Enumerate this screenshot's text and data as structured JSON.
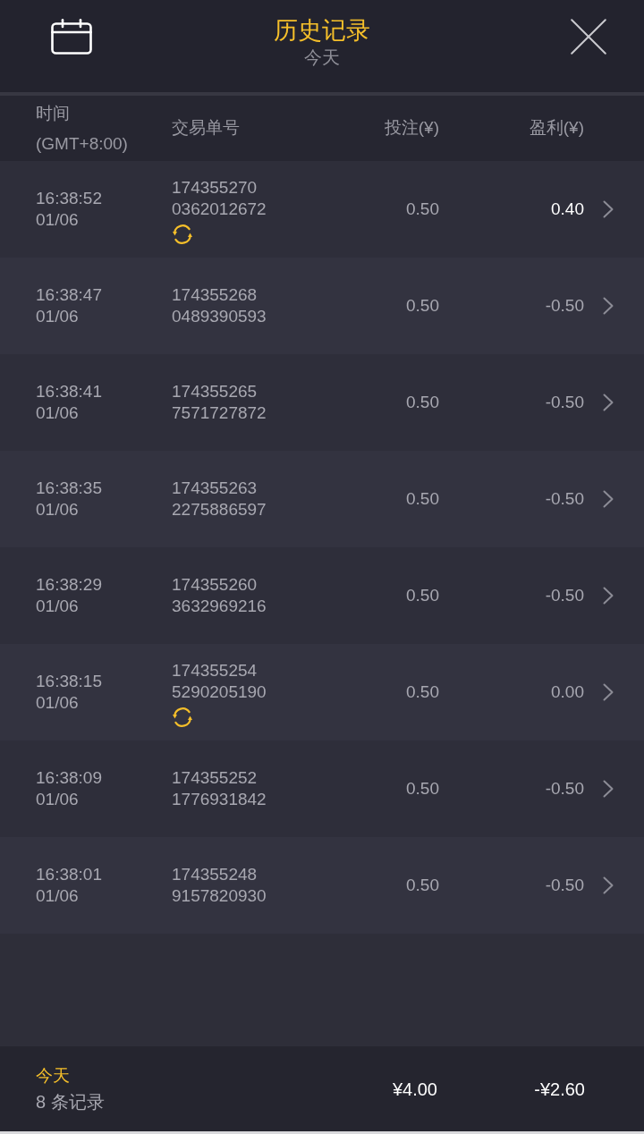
{
  "header": {
    "title": "历史记录",
    "subtitle": "今天"
  },
  "columns": [
    {
      "label": "时间",
      "sublabel": "(GMT+8:00)"
    },
    {
      "label": "交易单号"
    },
    {
      "label": "投注(¥)"
    },
    {
      "label": "盈利(¥)"
    }
  ],
  "rows": [
    {
      "time": "16:38:52",
      "date": "01/06",
      "order_no": [
        "174355270",
        "0362012672"
      ],
      "refresh_mark": true,
      "stake": "0.50",
      "profit": "0.40",
      "highlighted": true
    },
    {
      "time": "16:38:47",
      "date": "01/06",
      "order_no": [
        "174355268",
        "0489390593"
      ],
      "refresh_mark": false,
      "stake": "0.50",
      "profit": "-0.50",
      "highlighted": false
    },
    {
      "time": "16:38:41",
      "date": "01/06",
      "order_no": [
        "174355265",
        "7571727872"
      ],
      "refresh_mark": false,
      "stake": "0.50",
      "profit": "-0.50",
      "highlighted": false
    },
    {
      "time": "16:38:35",
      "date": "01/06",
      "order_no": [
        "174355263",
        "2275886597"
      ],
      "refresh_mark": false,
      "stake": "0.50",
      "profit": "-0.50",
      "highlighted": false
    },
    {
      "time": "16:38:29",
      "date": "01/06",
      "order_no": [
        "174355260",
        "3632969216"
      ],
      "refresh_mark": false,
      "stake": "0.50",
      "profit": "-0.50",
      "highlighted": false
    },
    {
      "time": "16:38:15",
      "date": "01/06",
      "order_no": [
        "174355254",
        "5290205190"
      ],
      "refresh_mark": true,
      "stake": "0.50",
      "profit": "0.00",
      "highlighted": false
    },
    {
      "time": "16:38:09",
      "date": "01/06",
      "order_no": [
        "174355252",
        "1776931842"
      ],
      "refresh_mark": false,
      "stake": "0.50",
      "profit": "-0.50",
      "highlighted": false
    },
    {
      "time": "16:38:01",
      "date": "01/06",
      "order_no": [
        "174355248",
        "9157820930"
      ],
      "refresh_mark": false,
      "stake": "0.50",
      "profit": "-0.50",
      "highlighted": false
    }
  ],
  "footer": {
    "period": "今天",
    "count": "8 条记录",
    "total_stake": "¥4.00",
    "total_profit": "-¥2.60"
  }
}
